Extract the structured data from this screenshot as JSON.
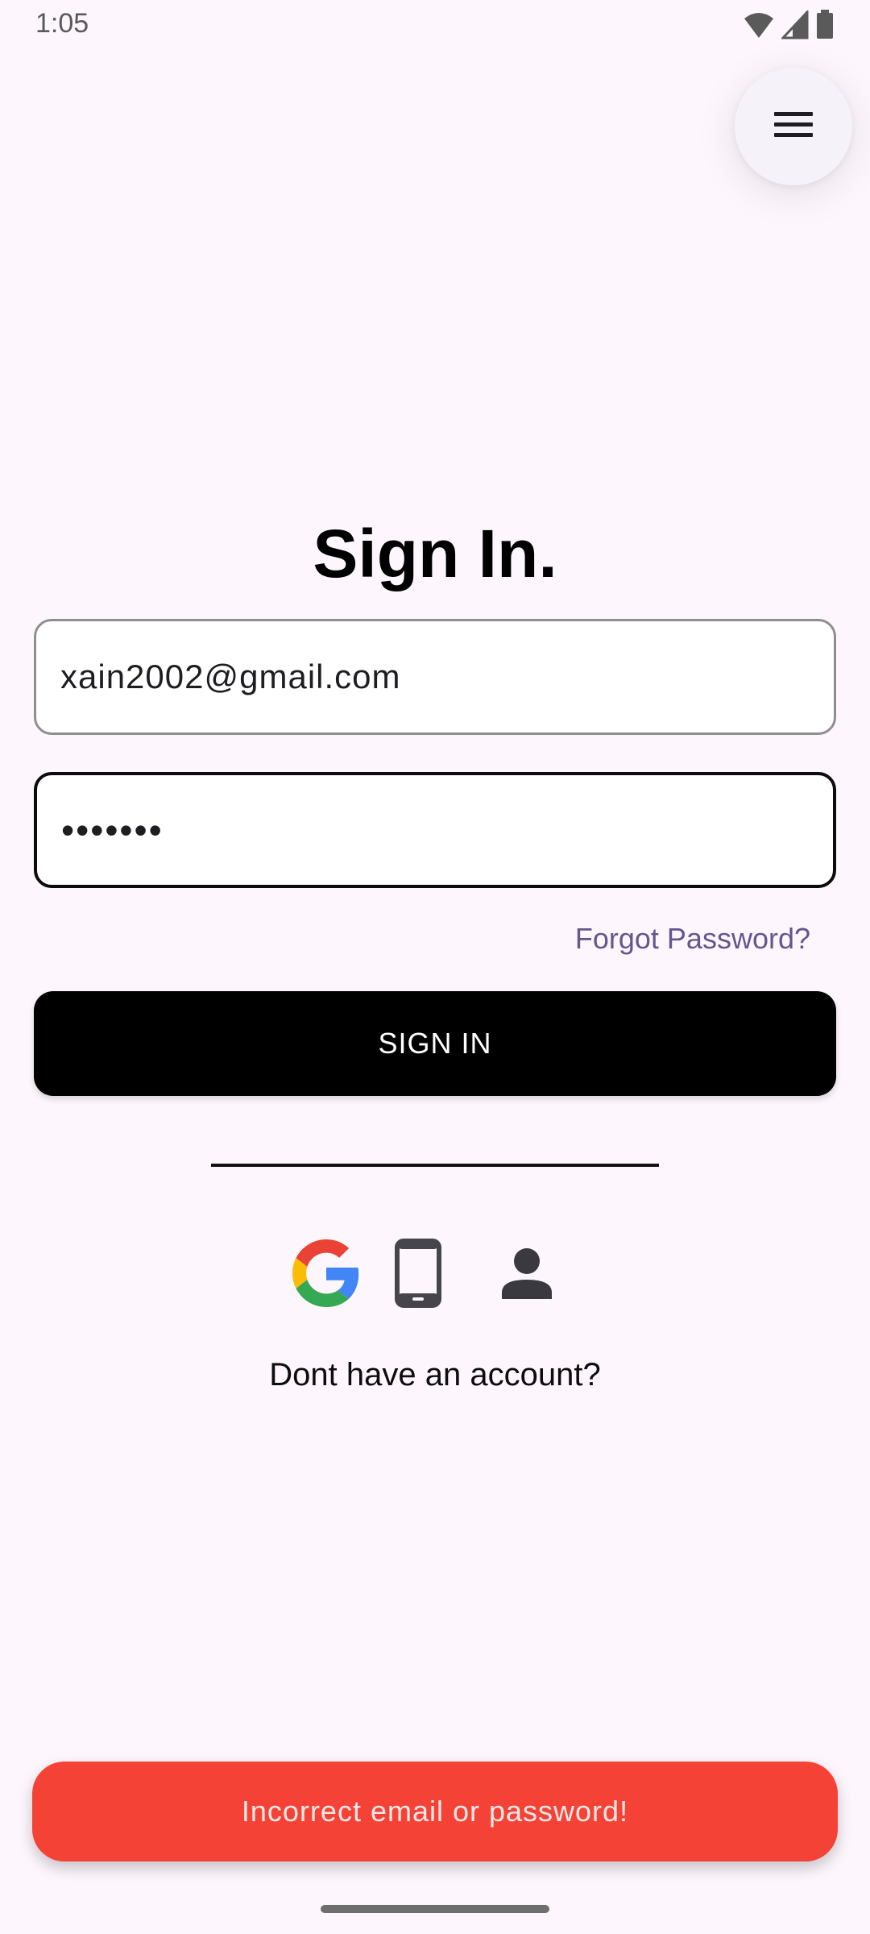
{
  "status_bar": {
    "time": "1:05",
    "icons": [
      "wifi-icon",
      "signal-icon",
      "battery-icon"
    ]
  },
  "menu_button": {
    "icon": "hamburger-menu-icon"
  },
  "page": {
    "title": "Sign In."
  },
  "form": {
    "email_value": "xain2002@gmail.com",
    "password_value": "•••••••",
    "forgot_label": "Forgot Password?",
    "signin_label": "SIGN IN"
  },
  "social": {
    "icons": [
      "google-icon",
      "phone-icon",
      "person-icon"
    ]
  },
  "signup": {
    "prompt": "Dont have an account?"
  },
  "snackbar": {
    "message": "Incorrect email or password!"
  },
  "colors": {
    "background": "#fdf7fd",
    "accent_link": "#66558f",
    "button": "#000000",
    "error": "#f44336"
  }
}
